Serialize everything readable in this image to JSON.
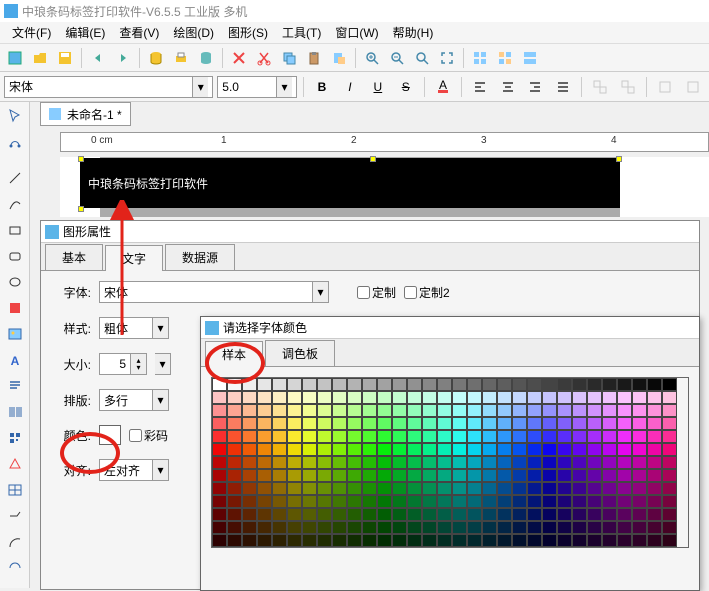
{
  "title": "中琅条码标签打印软件-V6.5.5 工业版 多机",
  "menus": [
    "文件(F)",
    "编辑(E)",
    "查看(V)",
    "绘图(D)",
    "图形(S)",
    "工具(T)",
    "窗口(W)",
    "帮助(H)"
  ],
  "font": {
    "name": "宋体",
    "size": "5.0"
  },
  "doc": {
    "tab": "未命名-1 *"
  },
  "ruler": {
    "unit_label": "0 cm",
    "ticks": [
      "1",
      "2",
      "3",
      "4"
    ]
  },
  "canvas_text": "中琅条码标签打印软件",
  "props": {
    "title": "图形属性",
    "tabs": [
      "基本",
      "文字",
      "数据源"
    ],
    "active_tab": 1,
    "font_label": "字体:",
    "font_value": "宋体",
    "custom1": "定制",
    "custom2": "定制2",
    "style_label": "样式:",
    "style_value": "粗体",
    "size_label": "大小:",
    "size_value": "5",
    "layout_label": "排版:",
    "layout_value": "多行",
    "color_label": "颜色:",
    "color_code": "彩码",
    "align_label": "对齐:",
    "align_value": "左对齐"
  },
  "color_dialog": {
    "title": "请选择字体颜色",
    "tabs": [
      "样本",
      "调色板"
    ],
    "active_tab": 0
  },
  "fmt": {
    "B": "B",
    "I": "I",
    "U": "U",
    "S": "S"
  }
}
